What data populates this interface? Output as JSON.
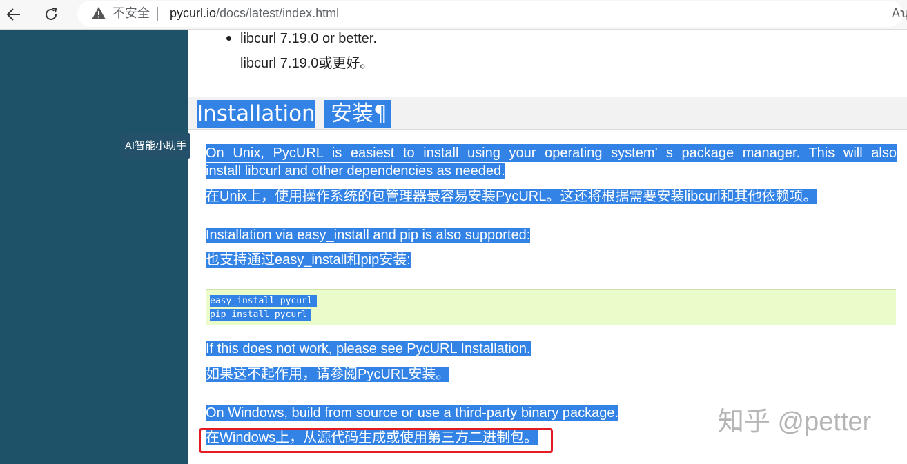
{
  "browser": {
    "security_label": "不安全",
    "url_host": "pycurl.io",
    "url_path": "/docs/latest/index.html",
    "read_aloud": "Aʮ"
  },
  "sidebar": {
    "assistant_label": "AI智能小助手"
  },
  "content": {
    "requirement_en": "libcurl 7.19.0 or better.",
    "requirement_zh": "libcurl 7.19.0或更好。",
    "heading_en": "Installation",
    "heading_zh": "安装¶",
    "unix_en_line1": "On Unix, PycURL is easiest to install using your operating system’ s package manager. This will also",
    "unix_en_line2": "install libcurl and other dependencies as needed.",
    "unix_zh": "在Unix上，使用操作系统的包管理器最容易安装PycURL。这还将根据需要安装libcurl和其他依赖项。",
    "pip_en": "Installation via easy_install and pip is also supported:",
    "pip_zh": "也支持通过easy_install和pip安装:",
    "code_line1": "easy_install pycurl",
    "code_line2": "pip install pycurl",
    "fail_en": "If this does not work, please see PycURL Installation.",
    "fail_zh": "如果这不起作用，请参阅PycURL安装。",
    "windows_en": "On Windows, build from source or use a third-party binary package.",
    "windows_zh": "在Windows上，从源代码生成或使用第三方二进制包。"
  },
  "watermark": "知乎 @petter",
  "colors": {
    "sidebar": "#1d5268",
    "selection": "#3383e6",
    "code_bg": "#e9fcc9",
    "highlight_box": "#e31b23"
  },
  "icons": [
    "back-arrow-icon",
    "reload-icon",
    "warning-icon"
  ]
}
